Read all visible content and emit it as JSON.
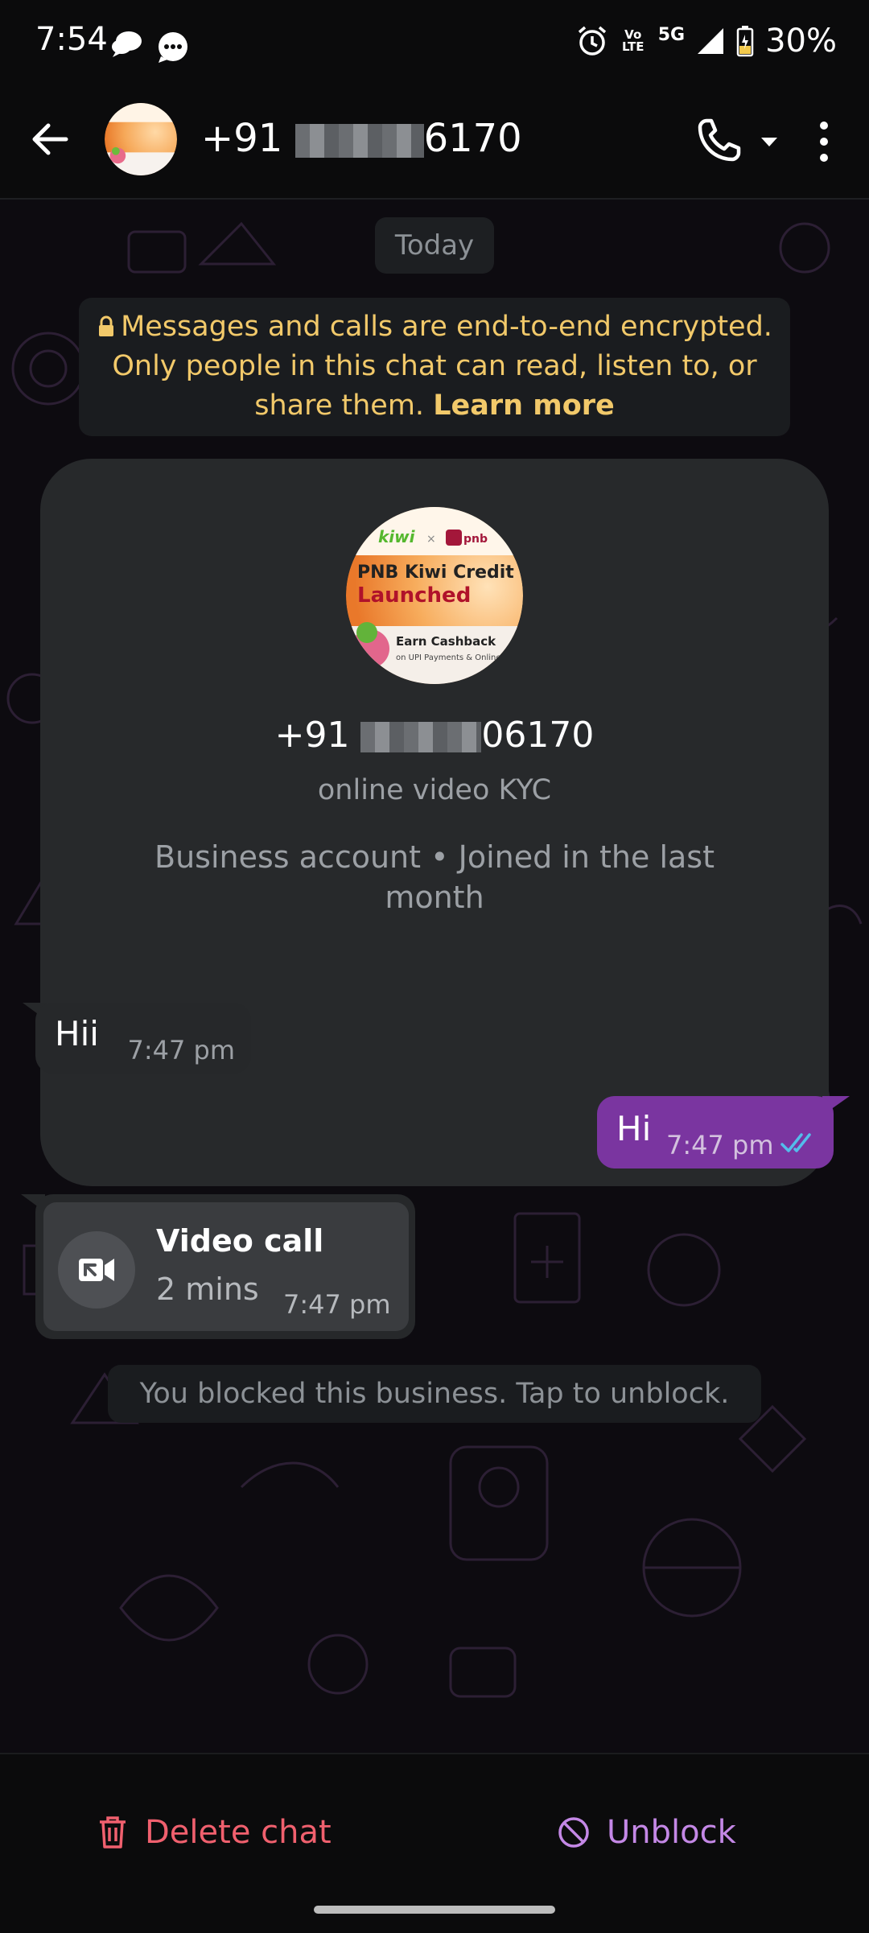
{
  "status_bar": {
    "time": "7:54",
    "network": "5G",
    "volte": "Vo LTE",
    "battery": "30%"
  },
  "header": {
    "contact_name": "+91 ",
    "contact_name_tail": "6170",
    "icons": [
      "back-arrow-icon",
      "phone-icon",
      "caret-down-icon",
      "more-vert-icon"
    ]
  },
  "chat": {
    "date_label": "Today",
    "encryption_notice": "Messages and calls are end-to-end encrypted. Only people in this chat can read, listen to, or share them.",
    "encryption_link": "Learn more",
    "profile": {
      "number_prefix": "+91 ",
      "number_suffix": "06170",
      "description": "online video KYC",
      "meta": "Business account • Joined in the last month",
      "avatar_text": {
        "brand1": "kiwi",
        "brand2": "pnb",
        "line1": "PNB Kiwi Credit C",
        "line2": "Launched",
        "line3": "Earn Cashback",
        "line4": "on UPI Payments & Online"
      }
    },
    "messages": [
      {
        "direction": "incoming",
        "text": "Hii",
        "time": "7:47 pm"
      },
      {
        "direction": "outgoing",
        "text": "Hi",
        "time": "7:47 pm",
        "status": "read"
      }
    ],
    "call": {
      "title": "Video call",
      "duration": "2 mins",
      "time": "7:47 pm"
    },
    "blocked_notice": "You blocked this business. Tap to unblock."
  },
  "bottom_actions": {
    "delete_label": "Delete chat",
    "unblock_label": "Unblock"
  },
  "colors": {
    "accent_out": "#7a35a0",
    "delete": "#f0606e",
    "unblock": "#c488e6",
    "notice_text": "#f2c96a"
  }
}
